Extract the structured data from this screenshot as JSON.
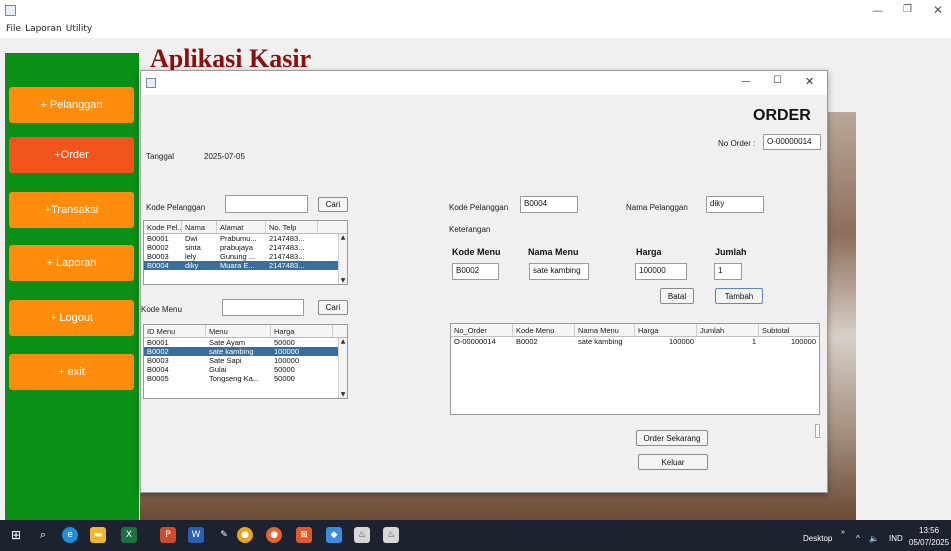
{
  "menubar": {
    "items": [
      "File",
      "Laporan",
      "Utility"
    ]
  },
  "app": {
    "title": "Aplikasi Kasir"
  },
  "sidebar": {
    "items": [
      {
        "label": "+ Pelanggan"
      },
      {
        "label": "+Order"
      },
      {
        "label": "+Transaksi"
      },
      {
        "label": "+ Laporan"
      },
      {
        "label": "+ Logout"
      },
      {
        "label": "+ exit"
      }
    ]
  },
  "dialog": {
    "heading": "ORDER",
    "no_order_label": "No Order :",
    "no_order_value": "O-00000014",
    "tanggal_label": "Tanggal",
    "tanggal_value": "2025-07-05",
    "kode_pelanggan_label": "Kode Pelanggan",
    "kode_pelanggan_search_value": "",
    "cari_label": "Cari",
    "kode_menu_label": "Kode Menu",
    "kode_menu_search_value": "",
    "right_kode_pelanggan_label": "Kode Pelanggan",
    "right_kode_pelanggan_value": "B0004",
    "nama_pelanggan_label": "Nama Pelanggan",
    "nama_pelanggan_value": "diky",
    "keterangan_label": "Keterangan",
    "entry_headers": {
      "kode_menu": "Kode Menu",
      "nama_menu": "Nama Menu",
      "harga": "Harga",
      "jumlah": "Jumlah"
    },
    "entry_values": {
      "kode_menu": "B0002",
      "nama_menu": "sate kambing",
      "harga": "100000",
      "jumlah": "1"
    },
    "batal_label": "Batal",
    "tambah_label": "Tambah",
    "order_sekarang_label": "Order Sekarang",
    "keluar_label": "Keluar"
  },
  "pelanggan_table": {
    "columns": [
      "Kode Pel...",
      "Nama",
      "Alamat",
      "No. Telp"
    ],
    "rows": [
      [
        "B0001",
        "Dwi",
        "Prabumu...",
        "2147483..."
      ],
      [
        "B0002",
        "sinta",
        "prabujaya",
        "2147483..."
      ],
      [
        "B0003",
        "lely",
        "Gunung ...",
        "2147483..."
      ],
      [
        "B0004",
        "diky",
        "Muara E...",
        "2147483..."
      ]
    ],
    "selected_row": 3
  },
  "menu_table": {
    "columns": [
      "ID Menu",
      "Menu",
      "Harga"
    ],
    "rows": [
      [
        "B0001",
        "Sate Ayam",
        "50000"
      ],
      [
        "B0002",
        "sate kambing",
        "100000"
      ],
      [
        "B0003",
        "Sate Sapi",
        "100000"
      ],
      [
        "B0004",
        "Gulai",
        "50000"
      ],
      [
        "B0005",
        "Tongseng Ka...",
        "50000"
      ]
    ],
    "selected_row": 1
  },
  "order_table": {
    "columns": [
      "No_Order",
      "Kode Menu",
      "Nama Menu",
      "Harga",
      "Jumlah",
      "Subtotal"
    ],
    "rows": [
      [
        "O-00000014",
        "B0002",
        "sate kambing",
        "100000",
        "1",
        "100000"
      ]
    ]
  },
  "taskbar": {
    "desktop_label": "Desktop",
    "lang": "IND",
    "time": "13:56",
    "date": "05/07/2025"
  },
  "colors": {
    "sidebar": "#0a8f17",
    "button": "#ff8c0c",
    "active_button": "#f2541b",
    "title": "#8b0f0f",
    "selection": "#386f9c"
  }
}
